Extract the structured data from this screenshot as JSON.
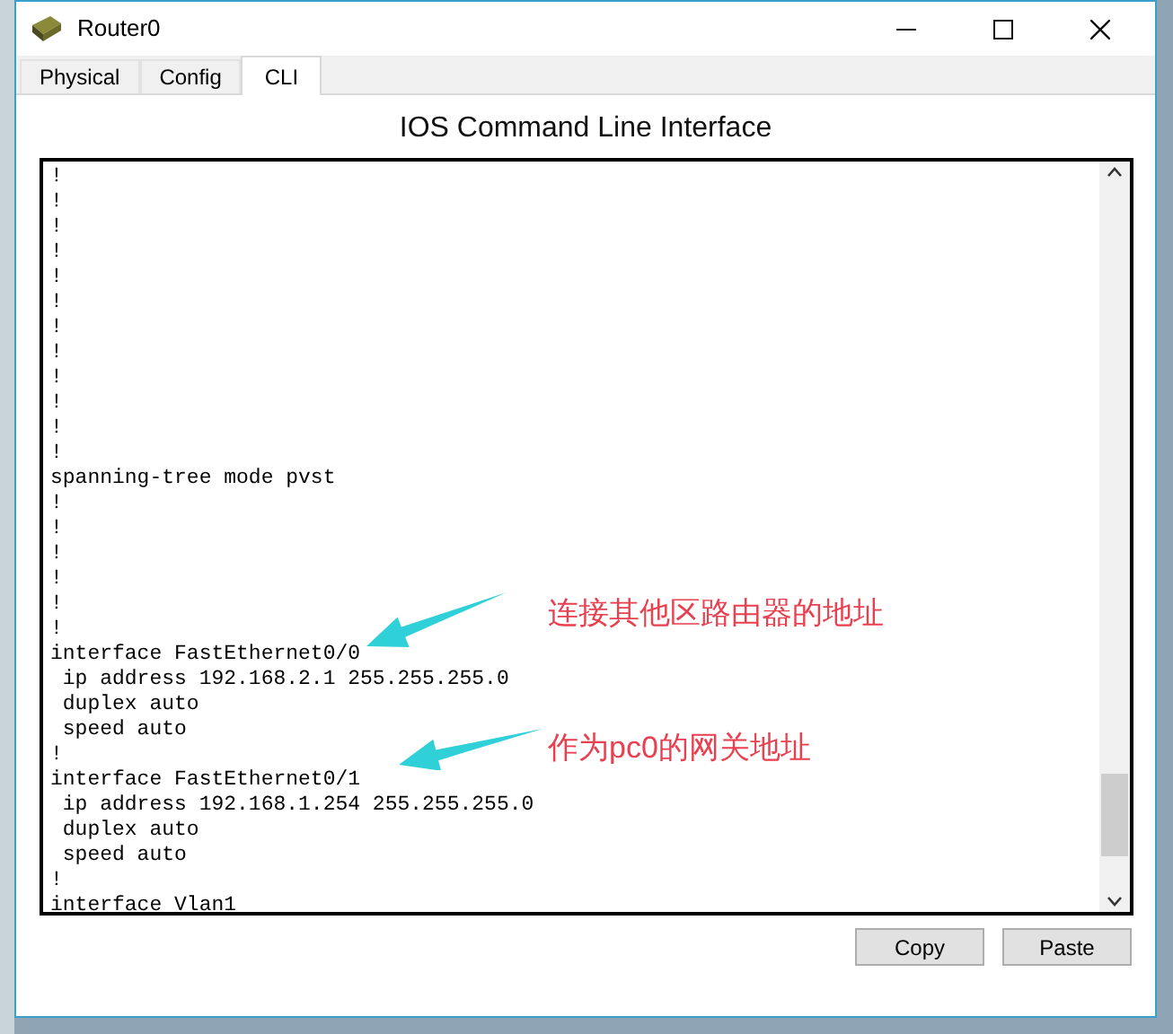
{
  "window": {
    "title": "Router0"
  },
  "tabs": [
    {
      "label": "Physical",
      "selected": false
    },
    {
      "label": "Config",
      "selected": false
    },
    {
      "label": "CLI",
      "selected": true
    }
  ],
  "heading": "IOS Command Line Interface",
  "console_lines": [
    "!",
    "!",
    "!",
    "!",
    "!",
    "!",
    "!",
    "!",
    "!",
    "!",
    "!",
    "!",
    "spanning-tree mode pvst",
    "!",
    "!",
    "!",
    "!",
    "!",
    "!",
    "interface FastEthernet0/0",
    " ip address 192.168.2.1 255.255.255.0",
    " duplex auto",
    " speed auto",
    "!",
    "interface FastEthernet0/1",
    " ip address 192.168.1.254 255.255.255.0",
    " duplex auto",
    " speed auto",
    "!",
    "interface Vlan1"
  ],
  "annotations": [
    {
      "text": "连接其他区路由器的地址"
    },
    {
      "text": "作为pc0的网关地址"
    }
  ],
  "buttons": [
    "Copy",
    "Paste"
  ]
}
